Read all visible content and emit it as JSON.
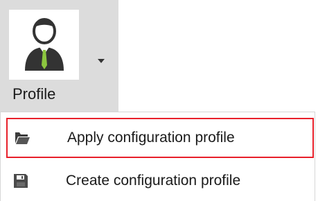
{
  "ribbon": {
    "profile_button": {
      "label": "Profile",
      "icon": "user-avatar-icon",
      "dropdown_icon": "dropdown-arrow-icon"
    }
  },
  "dropdown_menu": {
    "items": [
      {
        "label": "Apply configuration profile",
        "icon": "folder-open-icon",
        "highlighted": true
      },
      {
        "label": "Create configuration profile",
        "icon": "save-floppy-icon",
        "highlighted": false
      }
    ]
  },
  "colors": {
    "highlight_border": "#e8202a",
    "button_pressed_bg": "#dcdcdc",
    "tie_green": "#8cc63f"
  }
}
